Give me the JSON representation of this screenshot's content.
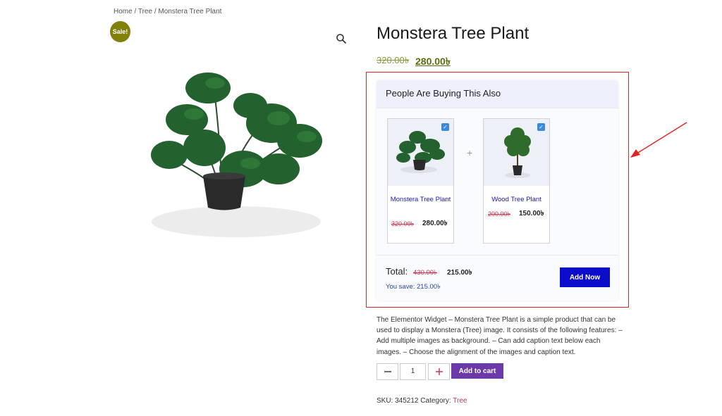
{
  "breadcrumb": {
    "home": "Home",
    "sep": " / ",
    "tree": "Tree",
    "current": "Monstera Tree Plant"
  },
  "sale_badge": "Sale!",
  "product": {
    "title": "Monstera Tree Plant",
    "price_old": "320.00৳",
    "price_new": "280.00৳",
    "description": "The Elementor Widget – Monstera Tree Plant is a simple product that can be used to display a Monstera (Tree) image. It consists of the following features: – Add multiple images as background. – Can add caption text below each images. – Choose the alignment of the images and caption text.",
    "quantity": "1",
    "add_to_cart": "Add to cart",
    "sku_label": "SKU:",
    "sku": "345212",
    "category_label": "Category:",
    "category": "Tree"
  },
  "bundle": {
    "heading": "People Are Buying This Also",
    "items": [
      {
        "name": "Monstera Tree Plant",
        "price_old": "320.00৳",
        "price_new": "280.00৳"
      },
      {
        "name": "Wood Tree Plant",
        "price_old": "200.00৳",
        "price_new": "150.00৳"
      }
    ],
    "plus": "+",
    "total_label": "Total:",
    "total_old": "430.00৳",
    "total_new": "215.00৳",
    "save_text": "You save: 215.00৳",
    "button": "Add Now"
  },
  "colors": {
    "accent_button": "#0b0bcc",
    "cart_button": "#6b3aa8",
    "highlight_box": "#e02424",
    "sale_badge": "#80800a"
  }
}
